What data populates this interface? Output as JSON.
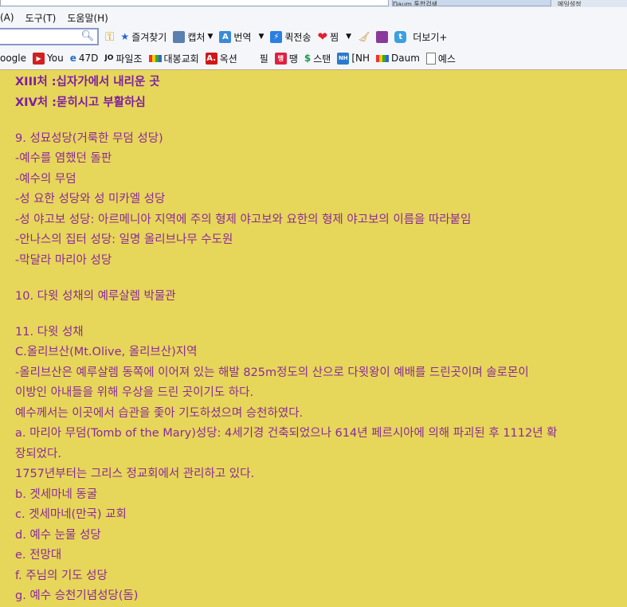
{
  "browser": {
    "tabs": [
      "Daum 통합검색",
      "메일설정"
    ],
    "menu": [
      "(A)",
      "도구(T)",
      "도움말(H)"
    ],
    "toolbar": [
      {
        "label": "즐겨찾기",
        "icon": "star-icon"
      },
      {
        "label": "캡처",
        "icon": "capture-icon"
      },
      {
        "label": "번역",
        "icon": "translate-icon"
      },
      {
        "label": "퀵전송",
        "icon": "quick-send-icon"
      },
      {
        "label": "찜",
        "icon": "heart-icon"
      },
      {
        "label": "더보기+",
        "icon": ""
      }
    ],
    "bookmarks": [
      {
        "label": "oogle",
        "icon": "google-icon"
      },
      {
        "label": "You",
        "icon": "youtube-icon"
      },
      {
        "label": "47D",
        "icon": "ie-icon"
      },
      {
        "label": "파일조",
        "icon": "file-icon"
      },
      {
        "label": "대봉교회",
        "icon": "daum-icon"
      },
      {
        "label": "옥션",
        "icon": "auction-icon"
      },
      {
        "label": "필",
        "icon": ""
      },
      {
        "label": "땡",
        "icon": "ttaeng-icon"
      },
      {
        "label": "스탠",
        "icon": "stan-icon"
      },
      {
        "label": "[NH",
        "icon": "nh-icon"
      },
      {
        "label": "Daum",
        "icon": "daum-icon"
      },
      {
        "label": "예스",
        "icon": "page-icon"
      }
    ]
  },
  "content": {
    "heading_lines": [
      "XIII처 :십자가에서 내리운 곳",
      "XIV처 :묻히시고 부활하심"
    ],
    "section9": [
      "9. 성묘성당(거룩한 무덤 성당)",
      "-예수를 염했던 돌판",
      "-예수의 무덤",
      "-성 요한 성당와 성 미카엘 성당",
      "-성 야고보 성당: 아르메니아 지역에 주의 형제 야고보와 요한의 형제 야고보의 이름을 따라붙임",
      "-안나스의 집터 성당: 일명 올리브나무 수도원",
      "-막달라 마리아 성당"
    ],
    "section10": [
      "10. 다윗 성채의 예루살렘 박물관"
    ],
    "section11": [
      "11. 다윗 성채",
      "C.올리브산(Mt.Olive, 올리브산)지역",
      "-올리브산은 예루살렘 동쪽에 이어져 있는 해발 825m정도의 산으로 다윗왕이 예배를 드린곳이며 솔로몬이",
      "이방인 아내들을 위해 우상을 드린 곳이기도 하다.",
      "예수께서는 이곳에서 습관을 좇아 기도하셨으며 승천하였다.",
      "a. 마리아 무덤(Tomb of the Mary)성당: 4세기경 건축되었으나 614년 페르시아에 의해 파괴된 후 1112년 확",
      "장되었다.",
      "1757년부터는 그리스 정교회에서 관리하고 있다.",
      "b. 겟세마네 동굴",
      "c. 겟세마네(만국) 교회",
      "d. 예수 눈물 성당",
      "e. 전망대",
      "f. 주님의 기도 성당",
      "g. 예수 승천기념성당(돔)"
    ]
  },
  "colors": {
    "background": "#e6d65a",
    "text": "#8b2a9a"
  }
}
